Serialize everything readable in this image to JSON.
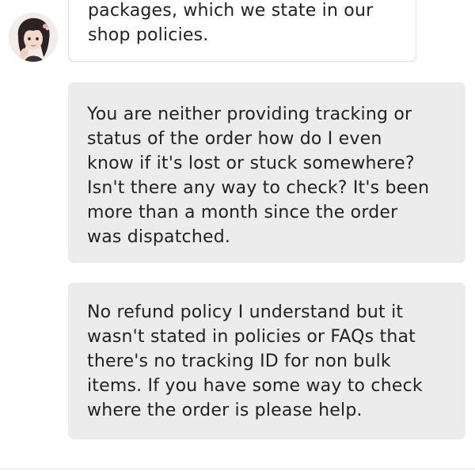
{
  "conversation": {
    "messages": [
      {
        "sender": "shop",
        "text": "packages, which we state in our\nshop policies."
      },
      {
        "sender": "me",
        "text": "You are neither providing tracking or\nstatus of the order how do I even\nknow if it's lost or stuck somewhere?\nIsn't there any way to check? It's been\nmore than a month since the order\nwas dispatched."
      },
      {
        "sender": "me",
        "text": "No refund policy I understand but it\nwasn't stated in policies or FAQs that\nthere's no tracking ID for non bulk\nitems. If you have some way to check\nwhere the order is please help."
      }
    ]
  },
  "colors": {
    "incoming_bubble_bg": "#ffffff",
    "incoming_bubble_border": "#dedede",
    "outgoing_bubble_bg": "#ececec",
    "text": "#222222"
  }
}
